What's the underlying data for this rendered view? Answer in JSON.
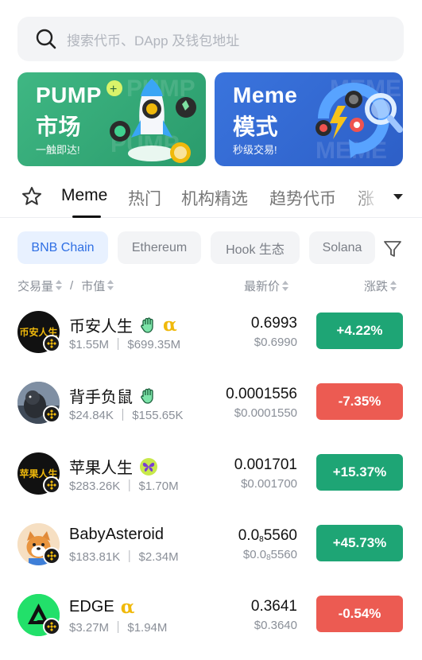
{
  "search": {
    "placeholder": "搜索代币、DApp 及钱包地址",
    "icon": "search-icon"
  },
  "banners": [
    {
      "title1": "PUMP",
      "title2": "市场",
      "subtitle": "一触即达!",
      "color": "#2f9f70"
    },
    {
      "title1": "Meme",
      "title2": "模式",
      "subtitle": "秒级交易!",
      "color": "#3168d6"
    }
  ],
  "tabs": {
    "items": [
      "Meme",
      "热门",
      "机构精选",
      "趋势代币",
      "涨"
    ],
    "active": "Meme"
  },
  "chains": {
    "items": [
      "BNB Chain",
      "Ethereum",
      "Hook 生态",
      "Solana"
    ],
    "active": "BNB Chain"
  },
  "columns": {
    "volume": "交易量",
    "separator": "/",
    "mcap": "市值",
    "price": "最新价",
    "change": "涨跌"
  },
  "tokens": [
    {
      "name": "币安人生",
      "avatar_text": "币安人生",
      "meta": "$1.55M ｜ $699.35M",
      "price": "0.6993",
      "price_usd": "$0.6990",
      "change": "+4.22%",
      "direction": "up",
      "tags": [
        "hand-icon",
        "alpha-icon"
      ]
    },
    {
      "name": "背手负鼠",
      "avatar_text": "",
      "meta": "$24.84K ｜ $155.65K",
      "price": "0.0001556",
      "price_usd": "$0.0001550",
      "change": "-7.35%",
      "direction": "down",
      "tags": [
        "hand-icon"
      ]
    },
    {
      "name": "苹果人生",
      "avatar_text": "苹果人生",
      "meta": "$283.26K ｜ $1.70M",
      "price": "0.001701",
      "price_usd": "$0.001700",
      "change": "+15.37%",
      "direction": "up",
      "tags": [
        "butterfly-icon"
      ]
    },
    {
      "name": "BabyAsteroid",
      "avatar_text": "",
      "meta": "$183.81K ｜ $2.34M",
      "price_prefix": "0.0",
      "price_sub": "8",
      "price_tail": "5560",
      "price_usd_prefix": "$0.0",
      "price_usd_sub": "8",
      "price_usd_tail": "5560",
      "change": "+45.73%",
      "direction": "up",
      "tags": []
    },
    {
      "name": "EDGE",
      "avatar_text": "",
      "meta": "$3.27M ｜ $1.94M",
      "price": "0.3641",
      "price_usd": "$0.3640",
      "change": "-0.54%",
      "direction": "down",
      "tags": [
        "alpha-icon"
      ]
    }
  ],
  "alpha_symbol": "α",
  "colors": {
    "up": "#1ea575",
    "down": "#ec5b52",
    "accent": "#2f6fe4",
    "alpha": "#f0b90b"
  }
}
